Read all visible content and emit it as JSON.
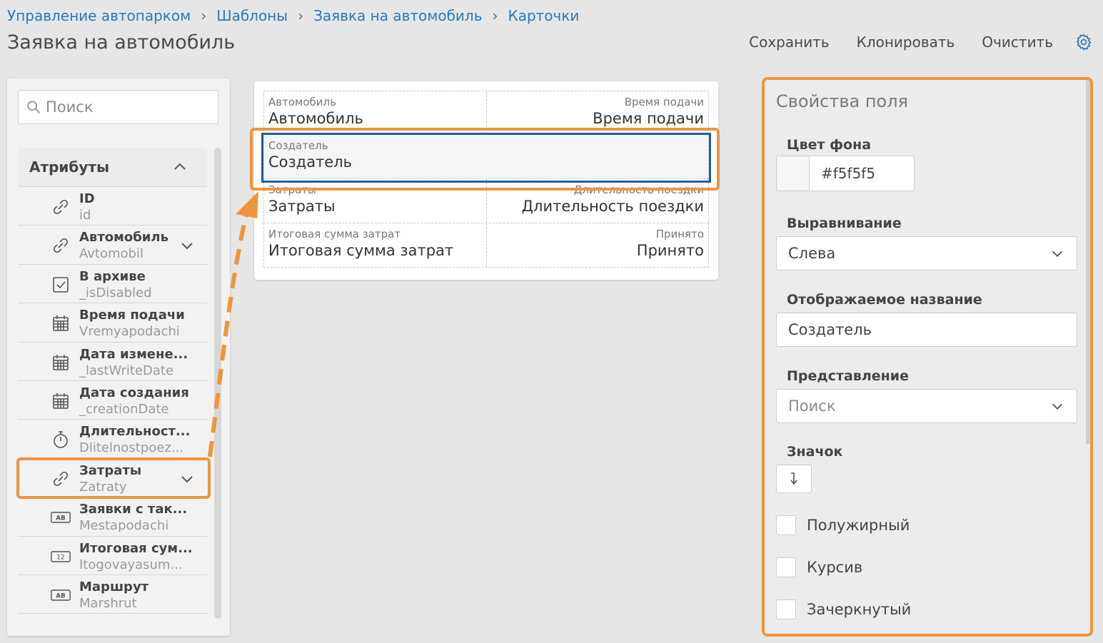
{
  "breadcrumb": [
    "Управление автопарком",
    "Шаблоны",
    "Заявка на автомобиль",
    "Карточки"
  ],
  "page_title": "Заявка на автомобиль",
  "toolbar": {
    "save": "Сохранить",
    "clone": "Клонировать",
    "clear": "Очистить",
    "settings_icon": "gear-icon"
  },
  "left": {
    "search_placeholder": "Поиск",
    "section_title": "Атрибуты",
    "items": [
      {
        "name": "ID",
        "code": "id",
        "icon": "link-icon",
        "expandable": false
      },
      {
        "name": "Автомобиль",
        "code": "Avtomobil",
        "icon": "link-icon",
        "expandable": true
      },
      {
        "name": "В архиве",
        "code": "_isDisabled",
        "icon": "checkbox-icon",
        "expandable": false
      },
      {
        "name": "Время подачи",
        "code": "Vremyapodachi",
        "icon": "calendar-icon",
        "expandable": false
      },
      {
        "name": "Дата измене...",
        "code": "_lastWriteDate",
        "icon": "calendar-icon",
        "expandable": false
      },
      {
        "name": "Дата создания",
        "code": "_creationDate",
        "icon": "calendar-icon",
        "expandable": false
      },
      {
        "name": "Длительност...",
        "code": "Dlitelnostpoez...",
        "icon": "stopwatch-icon",
        "expandable": false
      },
      {
        "name": "Затраты",
        "code": "Zatraty",
        "icon": "link-icon",
        "expandable": true
      },
      {
        "name": "Заявки с так...",
        "code": "Mestapodachi",
        "icon": "text-ab-icon",
        "expandable": false
      },
      {
        "name": "Итоговая сум...",
        "code": "Itogovayasum...",
        "icon": "number-12-icon",
        "expandable": false
      },
      {
        "name": "Маршрут",
        "code": "Marshrut",
        "icon": "text-ab-icon",
        "expandable": false
      }
    ]
  },
  "card": {
    "rows": [
      [
        {
          "label": "Автомобиль",
          "value": "Автомобиль"
        },
        {
          "label": "Время подачи",
          "value": "Время подачи"
        }
      ],
      [
        {
          "label": "Создатель",
          "value": "Создатель"
        }
      ],
      [
        {
          "label": "Затраты",
          "value": "Затраты"
        },
        {
          "label": "Длительность поездки",
          "value": "Длительность поездки"
        }
      ],
      [
        {
          "label": "Итоговая сумма затрат",
          "value": "Итоговая сумма затрат"
        },
        {
          "label": "Принято",
          "value": "Принято"
        }
      ]
    ]
  },
  "props": {
    "title": "Свойства поля",
    "bg_color_label": "Цвет фона",
    "bg_color_value": "#f5f5f5",
    "align_label": "Выравнивание",
    "align_value": "Слева",
    "display_name_label": "Отображаемое название",
    "display_name_value": "Создатель",
    "view_label": "Представление",
    "view_value": "Поиск",
    "icon_label": "Значок",
    "bold": "Полужирный",
    "italic": "Курсив",
    "strike": "Зачеркнутый"
  },
  "colors": {
    "accent": "#2b78b8",
    "highlight": "#f0943a",
    "selection": "#1e5fa0"
  }
}
